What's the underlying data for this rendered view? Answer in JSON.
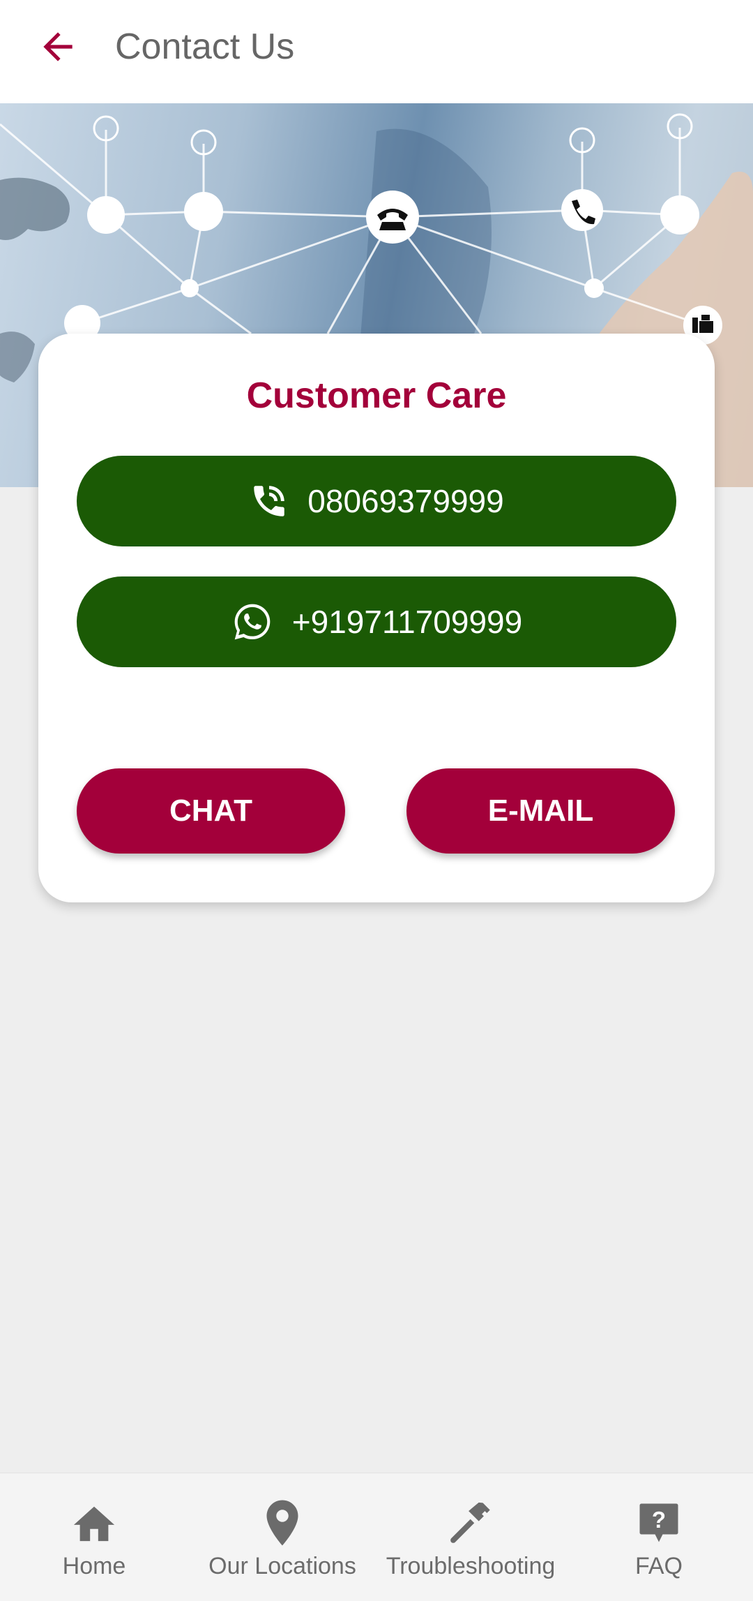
{
  "appbar": {
    "back_icon": "arrow-left-icon",
    "title": "Contact Us"
  },
  "colors": {
    "accent": "#a3003a",
    "green_button": "#1b5a05",
    "background": "#eeeeee",
    "nav_icon": "#6b6b6b"
  },
  "card": {
    "title": "Customer Care",
    "phone": {
      "icon": "phone-call-icon",
      "label": "08069379999"
    },
    "whatsapp": {
      "icon": "whatsapp-icon",
      "label": "+919711709999"
    },
    "chat_label": "CHAT",
    "email_label": "E-MAIL"
  },
  "bottom_nav": {
    "items": [
      {
        "icon": "home-icon",
        "label": "Home"
      },
      {
        "icon": "location-pin-icon",
        "label": "Our Locations"
      },
      {
        "icon": "hammer-icon",
        "label": "Troubleshooting"
      },
      {
        "icon": "question-chat-icon",
        "label": "FAQ"
      }
    ]
  }
}
